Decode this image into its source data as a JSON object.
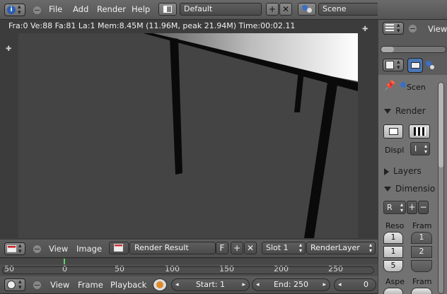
{
  "topbar": {
    "menus": [
      "File",
      "Add",
      "Render",
      "Help"
    ],
    "layout": "Default",
    "scene": "Scene",
    "view_label": "View"
  },
  "viewport": {
    "info": "Fra:0  Ve:88 Fa:81 La:1 Mem:8.45M (11.96M, peak 21.94M) Time:00:02.11"
  },
  "image_header": {
    "view": "View",
    "image": "Image",
    "image_name": "Render Result",
    "fake_user": "F",
    "slot": "Slot 1",
    "layer": "RenderLayer"
  },
  "timeline": {
    "ticks": [
      "50",
      "0",
      "50",
      "100",
      "150",
      "200",
      "250"
    ]
  },
  "bottombar": {
    "view": "View",
    "frame": "Frame",
    "playback": "Playback",
    "start": "Start: 1",
    "end": "End: 250",
    "current": "0"
  },
  "properties": {
    "scene_tab": "Scen",
    "render_section": "Render",
    "display_label": "Displ",
    "display_value": "I",
    "layers_section": "Layers",
    "dimensions_section": "Dimensio",
    "preset_value": "R",
    "resolution_label": "Reso",
    "frame_label": "Fram",
    "res_x": "1",
    "res_y": "1",
    "res_pct": "5",
    "frame_start": "1",
    "frame_end": "2",
    "aspect_label": "Aspe",
    "frame_label2": "Fram"
  }
}
